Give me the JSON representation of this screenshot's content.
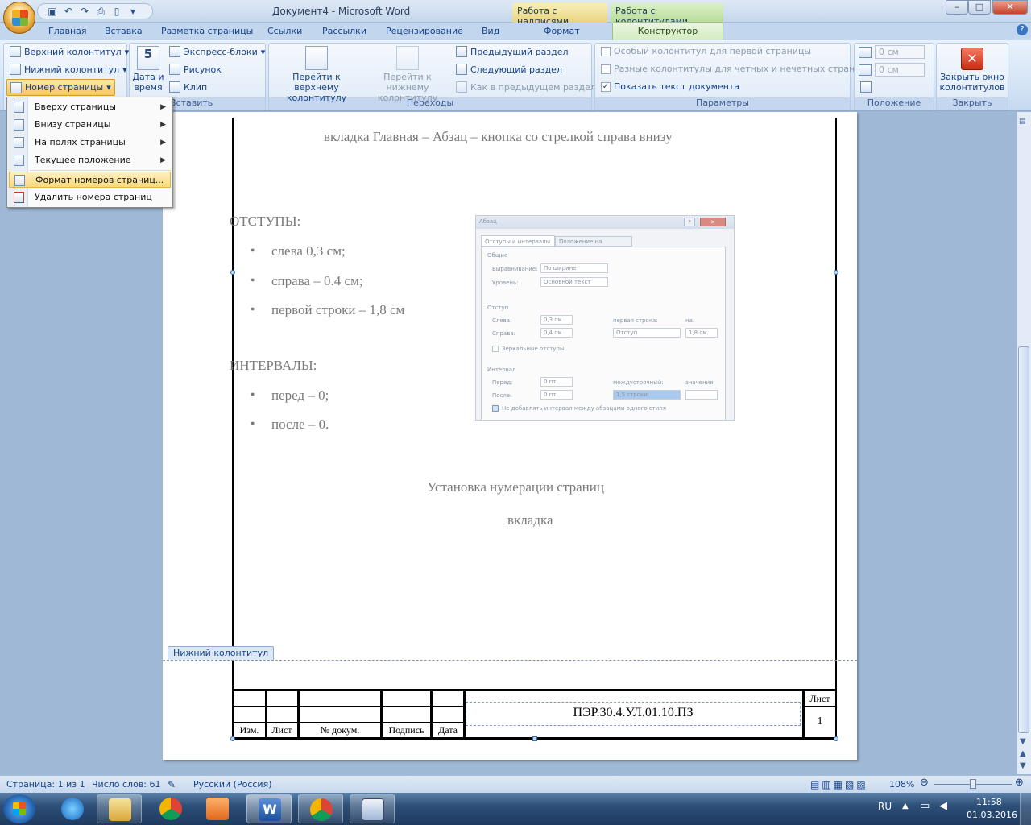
{
  "titlebar": {
    "title": "Документ4 - Microsoft Word",
    "context_tab_1": "Работа с надписями",
    "context_tab_2": "Работа с колонтитулами",
    "minimize": "–",
    "maximize": "□",
    "close": "✕"
  },
  "tabs": [
    "Главная",
    "Вставка",
    "Разметка страницы",
    "Ссылки",
    "Рассылки",
    "Рецензирование",
    "Вид",
    "Формат",
    "Конструктор"
  ],
  "ribbon": {
    "header_footer": {
      "header": "Верхний колонтитул",
      "footer": "Нижний колонтитул",
      "page_number": "Номер страницы"
    },
    "insert": {
      "date_time": "Дата и время",
      "express_blocks": "Экспресс-блоки",
      "picture": "Рисунок",
      "clip": "Клип",
      "label": "Вставить"
    },
    "navigation": {
      "goto_header": "Перейти к верхнему колонтитулу",
      "goto_footer": "Перейти к нижнему колонтитулу",
      "prev_section": "Предыдущий раздел",
      "next_section": "Следующий раздел",
      "link_prev": "Как в предыдущем разделе",
      "label": "Переходы"
    },
    "params": {
      "first_page": "Особый колонтитул для первой страницы",
      "odd_even": "Разные колонтитулы для четных и нечетных страниц",
      "show_text": "Показать текст документа",
      "label": "Параметры"
    },
    "position": {
      "top_value": "0 см",
      "bottom_value": "0 см",
      "label": "Положение"
    },
    "close": {
      "close_button": "Закрыть окно колонтитулов",
      "label": "Закрыть"
    }
  },
  "dropdown": {
    "items": [
      "Вверху страницы",
      "Внизу страницы",
      "На полях страницы",
      "Текущее положение",
      "Формат номеров страниц...",
      "Удалить номера страниц"
    ]
  },
  "document": {
    "top_line": "вкладка Главная – Абзац – кнопка со стрелкой  справа внизу",
    "indents_heading": "ОТСТУПЫ:",
    "indents": [
      "слева 0,3 см;",
      "справа – 0.4 см;",
      "первой строки – 1,8 см"
    ],
    "intervals_heading": "ИНТЕРВАЛЫ:",
    "intervals": [
      "перед – 0;",
      "после – 0."
    ],
    "center_1": "Установка нумерации страниц",
    "center_2": "вкладка",
    "footer_tag": "Нижний колонтитул"
  },
  "dialog": {
    "title": "Абзац",
    "tab1": "Отступы и интервалы",
    "tab2": "Положение на странице",
    "general": "Общие",
    "alignment_label": "Выравнивание:",
    "alignment_value": "По ширине",
    "level_label": "Уровень:",
    "level_value": "Основной текст",
    "indent": "Отступ",
    "left_label": "Слева:",
    "left_value": "0,3 см",
    "right_label": "Справа:",
    "right_value": "0,4 см",
    "first_line_label": "первая строка:",
    "first_line_value": "Отступ",
    "by_label": "на:",
    "by_value": "1,8 см",
    "mirror": "Зеркальные отступы",
    "interval": "Интервал",
    "before_label": "Перед:",
    "before_value": "0 пт",
    "after_label": "После:",
    "after_value": "0 пт",
    "line_spacing_label": "междустрочный:",
    "line_spacing_value": "1,5 строки",
    "value_label": "значение:",
    "no_interval": "Не добавлять интервал между абзацами одного стиля"
  },
  "stamp": {
    "code": "ПЭР.30.4.УЛ.01.10.ПЗ",
    "sheet_label": "Лист",
    "sheet_number": "1",
    "cols": [
      "Изм.",
      "Лист",
      "№ докум.",
      "Подпись",
      "Дата"
    ]
  },
  "status": {
    "page": "Страница: 1 из 1",
    "words": "Число слов: 61",
    "language": "Русский (Россия)",
    "zoom": "108%"
  },
  "taskbar": {
    "lang": "RU",
    "time": "11:58",
    "date": "01.03.2016"
  }
}
